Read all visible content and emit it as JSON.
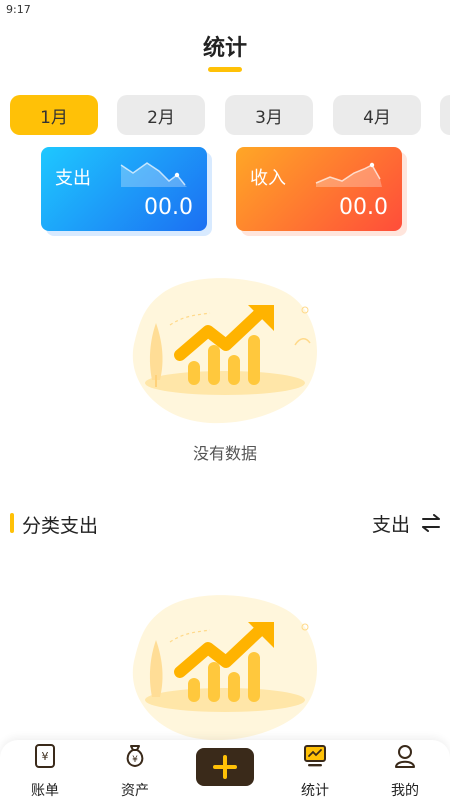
{
  "status_bar": {
    "time": "9:17"
  },
  "header": {
    "title": "统计"
  },
  "months": [
    "1月",
    "2月",
    "3月",
    "4月"
  ],
  "selected_month": "1月",
  "summary": {
    "expense": {
      "label": "支出",
      "amount": "00.0"
    },
    "income": {
      "label": "收入",
      "amount": "00.0"
    }
  },
  "empty": {
    "text": "没有数据"
  },
  "category": {
    "title": "分类支出",
    "toggle_label": "支出"
  },
  "tab_bar": {
    "items": [
      {
        "label": "账单",
        "icon": "bill-icon"
      },
      {
        "label": "资产",
        "icon": "money-bag-icon"
      },
      {
        "label": "",
        "icon": "add-icon"
      },
      {
        "label": "统计",
        "icon": "stats-icon"
      },
      {
        "label": "我的",
        "icon": "profile-icon"
      }
    ]
  },
  "colors": {
    "accent": "#FFC107",
    "expense_start": "#1ec8ff",
    "expense_end": "#1c6ff2",
    "income_start": "#ffa726",
    "income_end": "#ff4d3a",
    "add_button": "#3a2a1a"
  }
}
